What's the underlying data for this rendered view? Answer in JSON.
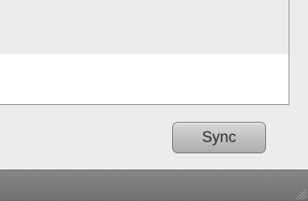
{
  "panel": {
    "rows": [
      {
        "label": ""
      },
      {
        "label": ""
      }
    ]
  },
  "actions": {
    "sync_label": "Sync"
  }
}
